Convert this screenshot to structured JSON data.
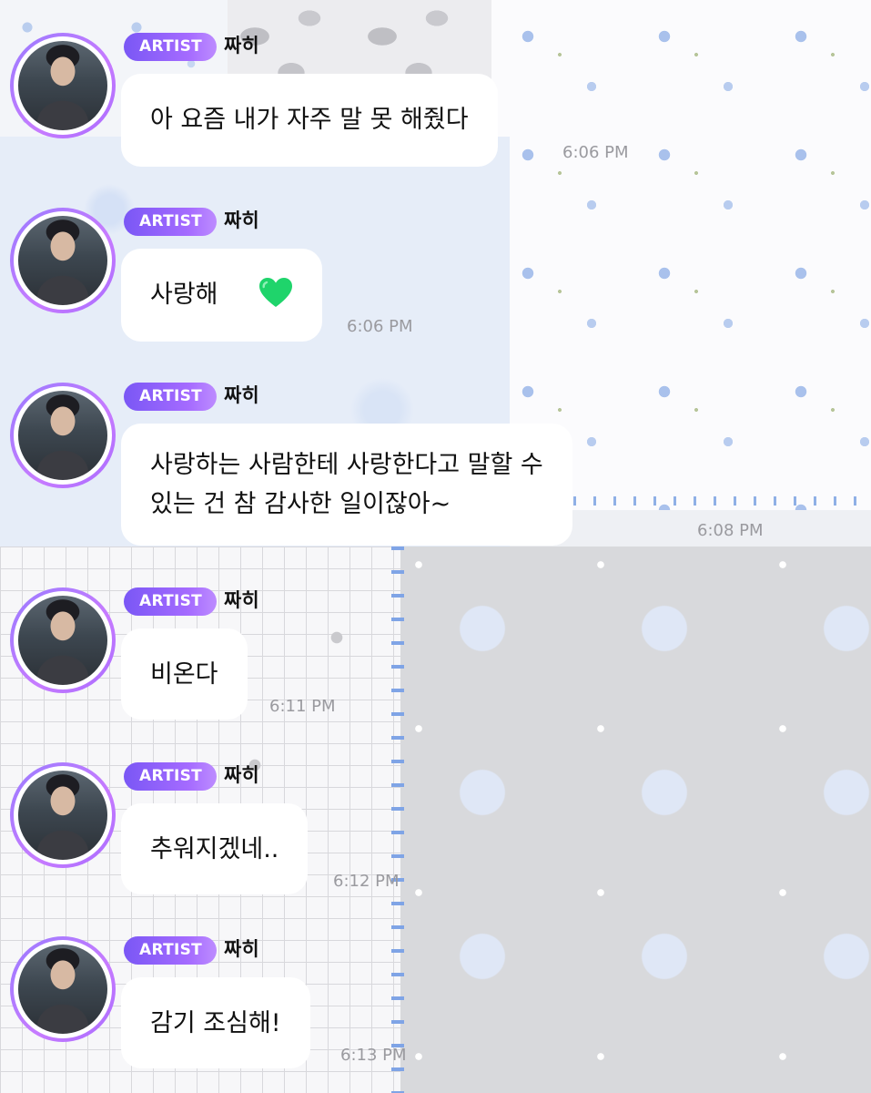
{
  "colors": {
    "badge_gradient_start": "#7a57f5",
    "badge_gradient_end": "#bd8cff",
    "avatar_ring": "#a86bff",
    "bubble_bg": "#ffffff",
    "timestamp": "#9a9a9f",
    "heart": "#1fd46b"
  },
  "messages": [
    {
      "badge": "ARTIST",
      "sender": "짜히",
      "lines": [
        "아 요즘 내가 자주 말 못 해줬다"
      ],
      "time": "6:06 PM"
    },
    {
      "badge": "ARTIST",
      "sender": "짜히",
      "lines": [
        "사랑해"
      ],
      "emoji": "green-heart-icon",
      "time": "6:06 PM"
    },
    {
      "badge": "ARTIST",
      "sender": "짜히",
      "lines": [
        "사랑하는 사람한테 사랑한다고 말할 수",
        "있는 건 참 감사한 일이잖아~"
      ],
      "time": "6:08 PM"
    },
    {
      "badge": "ARTIST",
      "sender": "짜히",
      "lines": [
        "비온다"
      ],
      "time": "6:11 PM"
    },
    {
      "badge": "ARTIST",
      "sender": "짜히",
      "lines": [
        "추워지겠네.."
      ],
      "time": "6:12 PM"
    },
    {
      "badge": "ARTIST",
      "sender": "짜히",
      "lines": [
        "감기 조심해!"
      ],
      "time": "6:13 PM"
    }
  ]
}
